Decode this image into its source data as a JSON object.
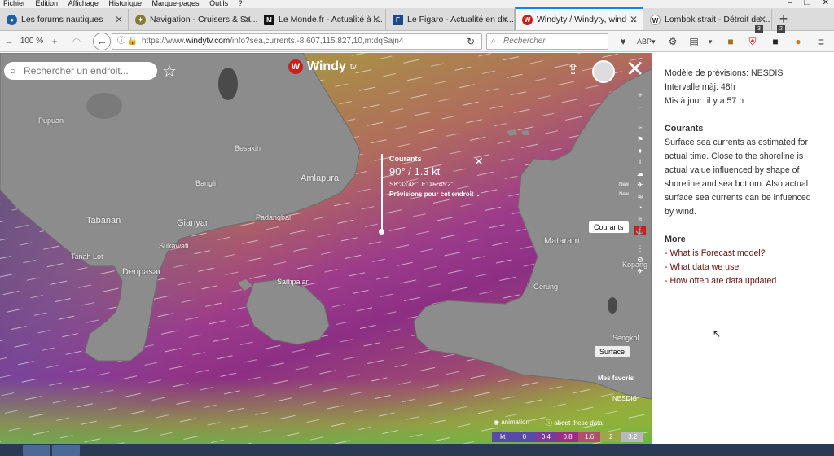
{
  "menu": [
    "Fichier",
    "Edition",
    "Affichage",
    "Historique",
    "Marque-pages",
    "Outils",
    "?"
  ],
  "window_controls": [
    "–",
    "❐",
    "✕"
  ],
  "tabs": [
    {
      "title": "Les forums nautiques",
      "favicon_color": "#1a5fa8",
      "active": false
    },
    {
      "title": "Navigation - Cruisers & Sa...",
      "favicon_color": "#8a7a3a",
      "active": false
    },
    {
      "title": "Le Monde.fr - Actualité à l...",
      "favicon_color": "#111111",
      "active": false
    },
    {
      "title": "Le Figaro - Actualité en dir...",
      "favicon_color": "#1a4a8a",
      "active": false
    },
    {
      "title": "Windyty / Windyty, wind ...",
      "favicon_color": "#c9201f",
      "active": true
    },
    {
      "title": "Lombok strait - Détroit de ...",
      "favicon_color": "#444444",
      "active": false
    }
  ],
  "navbar": {
    "zoom": "100 %",
    "url_prefix": "https://www.",
    "url_domain": "windytv.com",
    "url_path": "/info?sea,currents,-8.607,115.827,10,m:dqSajn4",
    "search_placeholder": "Rechercher",
    "badge_counts": [
      "3",
      "2"
    ]
  },
  "map": {
    "search_placeholder": "Rechercher un endroit...",
    "logo_text": "Windy",
    "logo_suffix": "tv",
    "places": [
      "Pupuan",
      "Besakih",
      "Amlapura",
      "Bangli",
      "Tabanan",
      "Gianyar",
      "Padangbai",
      "Sukawati",
      "Tanah Lot",
      "Denpasar",
      "Sampalan",
      "Mataram",
      "Gerung",
      "Kopang",
      "Sengkol"
    ],
    "popup": {
      "label": "Courants",
      "value": "90° / 1.3 kt",
      "coordinates": "S8°33'48\", E115°45'2\"",
      "forecast_link": "Prévisions pour cet endroit ⌄"
    },
    "overlay_tooltip": "Courants",
    "new_tag": "New",
    "surface_button": "Surface",
    "favorites_label": "Mes favoris",
    "source_label": "NESDIS",
    "animation_label": "animation",
    "about_label": "about these data",
    "legend": [
      "kt",
      "0",
      "0.4",
      "0.8",
      "1.6",
      "2",
      "3.2"
    ],
    "legend_colors": [
      "#5a4aa8",
      "#5a4aa8",
      "#7a3a9a",
      "#9c2f84",
      "#b0506a",
      "#9aa84a",
      "#b8b8b8"
    ]
  },
  "sidebar": {
    "lines": [
      "Modèle de prévisions: NESDIS",
      "Intervalle màj: 48h",
      "Mis à jour: il y a 57 h"
    ],
    "currents_heading": "Courants",
    "currents_text": "Surface sea currents as estimated for actual time. Close to the shoreline is actual value influenced by shape of shoreline and sea bottom. Also actual surface sea currents can be infuenced by wind.",
    "more_heading": "More",
    "links": [
      "- What is Forecast model?",
      "- What data we use",
      "- How often are data updated"
    ]
  }
}
